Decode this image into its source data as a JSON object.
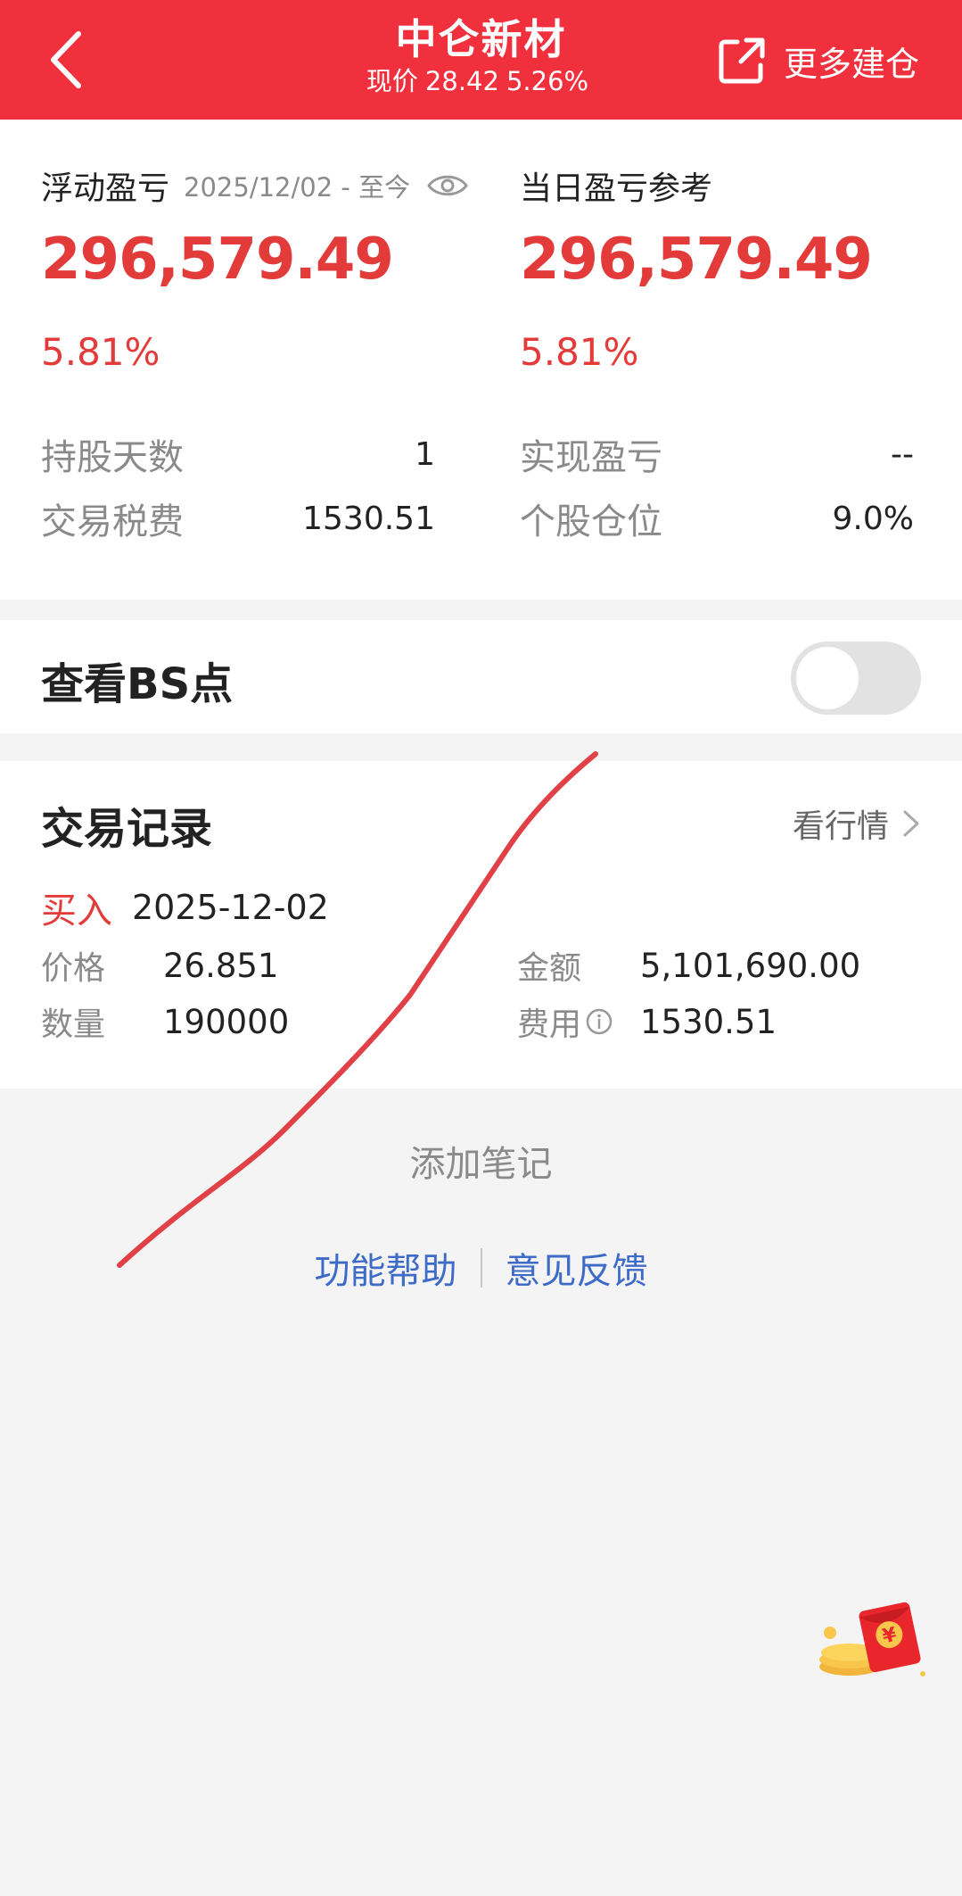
{
  "header": {
    "title": "中仑新材",
    "price_label": "现价",
    "price": "28.42",
    "change_pct": "5.26%",
    "more_label": "更多建仓"
  },
  "summary": {
    "floating": {
      "label": "浮动盈亏",
      "date_range": "2025/12/02 - 至今",
      "value": "296,579.49",
      "pct": "5.81%"
    },
    "daily": {
      "label": "当日盈亏参考",
      "value": "296,579.49",
      "pct": "5.81%"
    },
    "hold_days": {
      "label": "持股天数",
      "value": "1"
    },
    "realized": {
      "label": "实现盈亏",
      "value": "--"
    },
    "tax_fee": {
      "label": "交易税费",
      "value": "1530.51"
    },
    "position": {
      "label": "个股仓位",
      "value": "9.0%"
    }
  },
  "bs_toggle": {
    "label": "查看BS点",
    "on": false
  },
  "trades": {
    "title": "交易记录",
    "view_quote": "看行情",
    "records": [
      {
        "type": "买入",
        "date": "2025-12-02",
        "price_label": "价格",
        "price": "26.851",
        "amount_label": "金额",
        "amount": "5,101,690.00",
        "qty_label": "数量",
        "qty": "190000",
        "fee_label": "费用",
        "fee": "1530.51"
      }
    ]
  },
  "add_note": "添加笔记",
  "footer": {
    "help": "功能帮助",
    "feedback": "意见反馈"
  },
  "colors": {
    "brand_red": "#f0313d",
    "profit_red": "#e33a3a",
    "link_blue": "#3d6bc7"
  },
  "icons": [
    "back-arrow-icon",
    "share-external-icon",
    "eye-icon",
    "chevron-right-icon",
    "info-icon",
    "red-envelope-icon"
  ]
}
